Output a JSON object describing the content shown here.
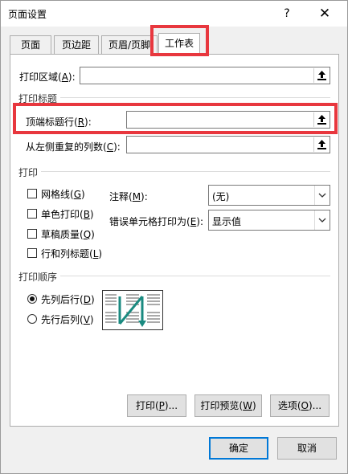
{
  "dialog": {
    "title": "页面设置",
    "help": "?",
    "close": "✕"
  },
  "tabs": [
    {
      "label": "页面"
    },
    {
      "label": "页边距"
    },
    {
      "label": "页眉/页脚"
    },
    {
      "label": "工作表"
    }
  ],
  "active_tab": "工作表",
  "print_area": {
    "label": "打印区域(",
    "key": "A",
    "suffix": "):",
    "value": ""
  },
  "print_titles": {
    "section": "打印标题",
    "top_rows": {
      "label": "顶端标题行(",
      "key": "R",
      "suffix": "):",
      "value": ""
    },
    "left_cols": {
      "label": "从左侧重复的列数(",
      "key": "C",
      "suffix": "):",
      "value": ""
    }
  },
  "print": {
    "section": "打印",
    "gridlines": {
      "label": "网格线(",
      "key": "G",
      "suffix": ")",
      "checked": false
    },
    "black_white": {
      "label": "单色打印(",
      "key": "B",
      "suffix": ")",
      "checked": false
    },
    "draft": {
      "label": "草稿质量(",
      "key": "Q",
      "suffix": ")",
      "checked": false
    },
    "headings": {
      "label": "行和列标题(",
      "key": "L",
      "suffix": ")",
      "checked": false
    },
    "comments": {
      "label": "注释(",
      "key": "M",
      "suffix": "):",
      "value": "(无)"
    },
    "errors": {
      "label": "错误单元格打印为(",
      "key": "E",
      "suffix": "):",
      "value": "显示值"
    }
  },
  "page_order": {
    "section": "打印顺序",
    "down_then_over": {
      "label": "先列后行(",
      "key": "D",
      "suffix": ")",
      "selected": true
    },
    "over_then_down": {
      "label": "先行后列(",
      "key": "V",
      "suffix": ")",
      "selected": false
    }
  },
  "buttons": {
    "print": {
      "label": "打印(",
      "key": "P",
      "suffix": ")..."
    },
    "preview": {
      "label": "打印预览(",
      "key": "W",
      "suffix": ")"
    },
    "options": {
      "label": "选项(",
      "key": "O",
      "suffix": ")..."
    },
    "ok": "确定",
    "cancel": "取消"
  },
  "colors": {
    "highlight": "#e8373e",
    "accent": "#0078d7",
    "order_arrow": "#2aa198"
  }
}
